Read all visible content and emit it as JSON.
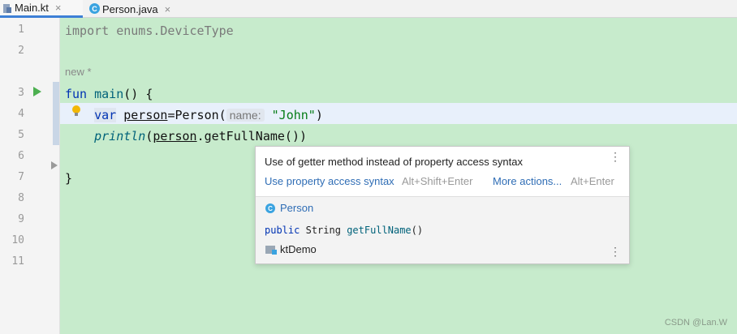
{
  "tabs": [
    {
      "label": "Main.kt",
      "active": true,
      "icon": "kotlin-file-icon"
    },
    {
      "label": "Person.java",
      "active": false,
      "icon": "java-class-icon",
      "badge": "C"
    }
  ],
  "tab_close_glyph": "×",
  "line_numbers": [
    "1",
    "2",
    "3",
    "4",
    "5",
    "6",
    "7",
    "8",
    "9",
    "10",
    "11"
  ],
  "code": {
    "line1": {
      "kw": "import",
      "rest": " enums.DeviceType"
    },
    "new_label": "new *",
    "line3": {
      "kw": "fun",
      "fn": "main",
      "rest": "() {"
    },
    "line4": {
      "kw": "var",
      "var": "person",
      "eq": "=Person(",
      "hint": "name:",
      "str": "\"John\"",
      "close": ")"
    },
    "line5": {
      "fn": "println",
      "open": "(",
      "var": "person",
      "call": ".getFullName())"
    },
    "line7": "}"
  },
  "popup": {
    "message": "Use of getter method instead of property access syntax",
    "action1": "Use property access syntax",
    "shortcut1": "Alt+Shift+Enter",
    "action2": "More actions...",
    "shortcut2": "Alt+Enter",
    "class_badge": "C",
    "class_name": "Person",
    "sig_kw": "public",
    "sig_type": "String",
    "sig_fn": "getFullName",
    "sig_paren": "()",
    "module": "ktDemo",
    "menu_glyph": "⋮"
  },
  "watermark": "CSDN @Lan.W",
  "colors": {
    "editor_bg": "#c7ebcc",
    "keyword": "#0033b3",
    "string": "#067d17",
    "link": "#2f6db5"
  }
}
